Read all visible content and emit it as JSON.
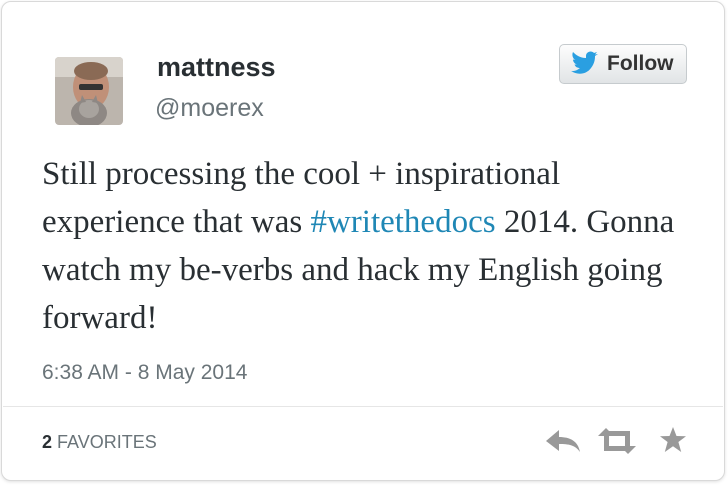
{
  "user": {
    "display_name": "mattness",
    "handle": "@moerex"
  },
  "follow_button": {
    "label": "Follow",
    "icon": "twitter-bird-icon"
  },
  "tweet": {
    "text_before": "Still processing the cool + inspirational experience that was ",
    "hashtag": "#writethedocs",
    "text_after": " 2014. Gonna watch my be-verbs and hack my English going forward!",
    "timestamp": "6:38 AM - 8 May 2014"
  },
  "stats": {
    "favorites_count": "2",
    "favorites_label": "FAVORITES"
  },
  "actions": [
    {
      "icon": "reply-icon"
    },
    {
      "icon": "retweet-icon"
    },
    {
      "icon": "favorite-star-icon"
    }
  ],
  "colors": {
    "hashtag": "#1f87b5",
    "twitter_blue": "#2a9fe1",
    "text": "#292f33",
    "muted": "#6a7479",
    "action_icon": "#999999"
  }
}
